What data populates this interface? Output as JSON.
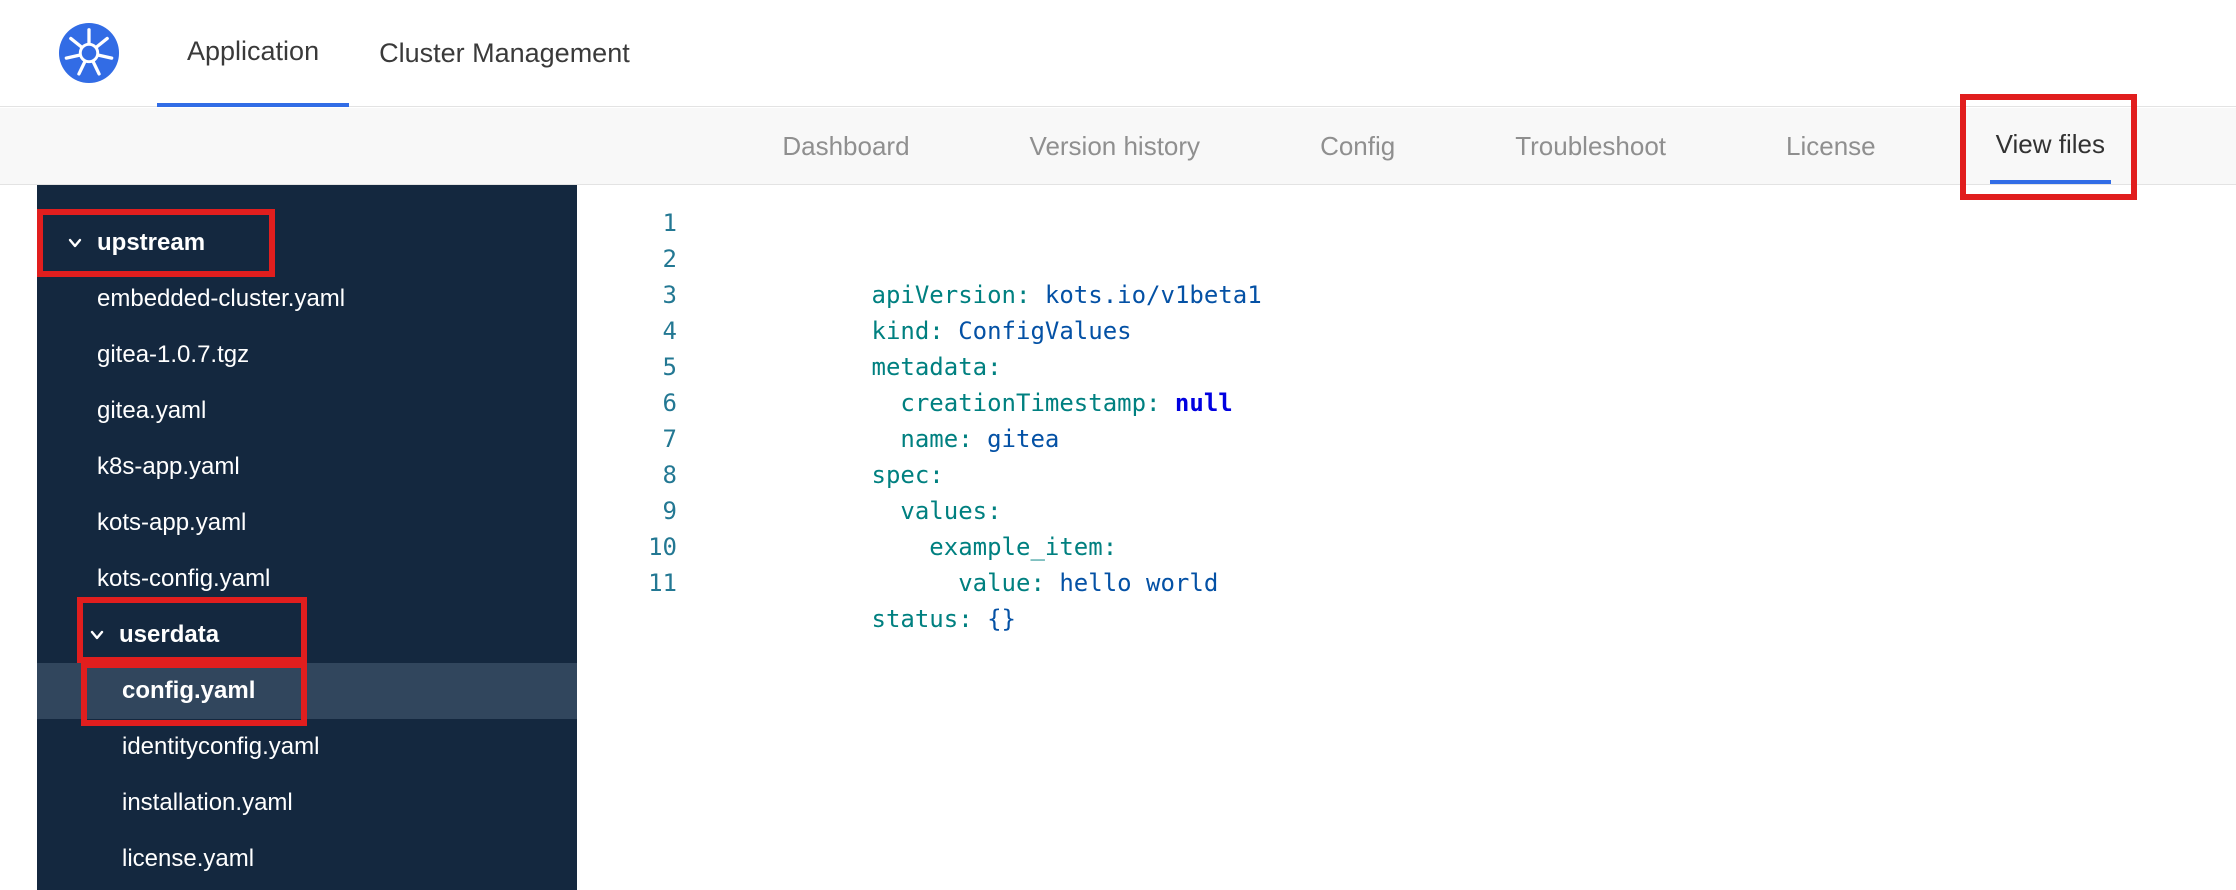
{
  "colors": {
    "accent": "#326de6",
    "annotation": "#e11e1e",
    "sidebar-bg": "#14283f",
    "sidebar-selected": "#31465d",
    "tok-key": "#008080",
    "tok-val": "#0451a5",
    "tok-kw": "#0000e0",
    "gutter": "#237893",
    "k8s-blue": "#326ce5"
  },
  "header": {
    "tabs": [
      {
        "label": "Application",
        "cls": "active"
      },
      {
        "label": "Cluster Management"
      }
    ]
  },
  "subnav": {
    "tabs": [
      {
        "label": "Dashboard"
      },
      {
        "label": "Version history"
      },
      {
        "label": "Config"
      },
      {
        "label": "Troubleshoot"
      },
      {
        "label": "License"
      },
      {
        "label": "View files",
        "cls": "active annotated"
      }
    ]
  },
  "file_tree": {
    "items": [
      {
        "label": "upstream",
        "cls": "folder level-0"
      },
      {
        "label": "embedded-cluster.yaml",
        "cls": "file level-1"
      },
      {
        "label": "gitea-1.0.7.tgz",
        "cls": "file level-1"
      },
      {
        "label": "gitea.yaml",
        "cls": "file level-1"
      },
      {
        "label": "k8s-app.yaml",
        "cls": "file level-1"
      },
      {
        "label": "kots-app.yaml",
        "cls": "file level-1"
      },
      {
        "label": "kots-config.yaml",
        "cls": "file level-1"
      },
      {
        "label": "userdata",
        "cls": "folder level-1b"
      },
      {
        "label": "config.yaml",
        "cls": "file level-2 selected"
      },
      {
        "label": "identityconfig.yaml",
        "cls": "file level-2"
      },
      {
        "label": "installation.yaml",
        "cls": "file level-2"
      },
      {
        "label": "license.yaml",
        "cls": "file level-2"
      }
    ]
  },
  "editor": {
    "lines": [
      {
        "num": "1",
        "parts": [
          {
            "t": "apiVersion:",
            "cls": "tok-key"
          },
          {
            "t": " kots.io/v1beta1",
            "cls": "tok-val"
          }
        ]
      },
      {
        "num": "2",
        "parts": [
          {
            "t": "kind:",
            "cls": "tok-key"
          },
          {
            "t": " ConfigValues",
            "cls": "tok-val"
          }
        ]
      },
      {
        "num": "3",
        "parts": [
          {
            "t": "metadata:",
            "cls": "tok-key"
          }
        ]
      },
      {
        "num": "4",
        "parts": [
          {
            "t": "  creationTimestamp:",
            "cls": "tok-key"
          },
          {
            "t": " null",
            "cls": "tok-kw"
          }
        ]
      },
      {
        "num": "5",
        "parts": [
          {
            "t": "  name:",
            "cls": "tok-key"
          },
          {
            "t": " gitea",
            "cls": "tok-val"
          }
        ]
      },
      {
        "num": "6",
        "parts": [
          {
            "t": "spec:",
            "cls": "tok-key"
          }
        ]
      },
      {
        "num": "7",
        "parts": [
          {
            "t": "  values:",
            "cls": "tok-key"
          }
        ]
      },
      {
        "num": "8",
        "parts": [
          {
            "t": "    example_item:",
            "cls": "tok-key"
          }
        ]
      },
      {
        "num": "9",
        "parts": [
          {
            "t": "      value:",
            "cls": "tok-key"
          },
          {
            "t": " hello world",
            "cls": "tok-val"
          }
        ]
      },
      {
        "num": "10",
        "parts": [
          {
            "t": "status:",
            "cls": "tok-key"
          },
          {
            "t": " {}",
            "cls": "tok-val"
          }
        ]
      },
      {
        "num": "11",
        "parts": []
      }
    ]
  }
}
